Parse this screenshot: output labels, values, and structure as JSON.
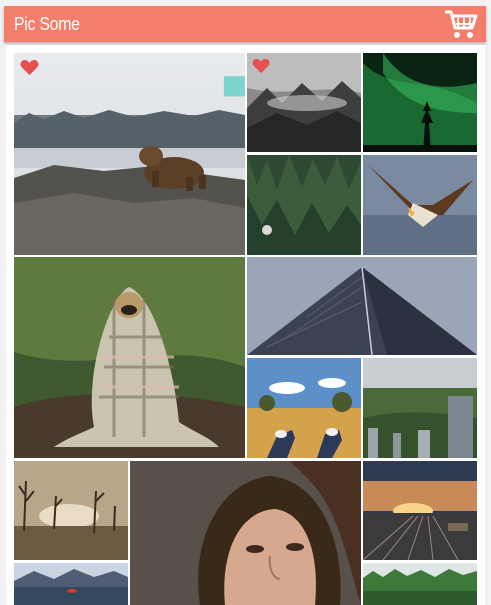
{
  "app": {
    "title": "Pic Some",
    "accent_color": "#f47e6c"
  },
  "header": {
    "cart_icon": "cart-icon"
  },
  "gallery": {
    "photos": [
      {
        "name": "photo-bear",
        "subject": "bear",
        "favorited": true,
        "in_cart": false
      },
      {
        "name": "photo-foggy-forest",
        "subject": "foggy-forest",
        "favorited": true,
        "in_cart": false
      },
      {
        "name": "photo-aurora",
        "subject": "aurora",
        "favorited": false,
        "in_cart": false
      },
      {
        "name": "photo-green-forest",
        "subject": "green-forest",
        "favorited": false,
        "in_cart": false
      },
      {
        "name": "photo-eagle",
        "subject": "eagle",
        "favorited": false,
        "in_cart": false
      },
      {
        "name": "photo-pug-blanket",
        "subject": "pug-in-blanket",
        "favorited": false,
        "in_cart": false
      },
      {
        "name": "photo-skyscraper",
        "subject": "skyscraper",
        "favorited": false,
        "in_cart": false
      },
      {
        "name": "photo-field-feet",
        "subject": "feet-in-field",
        "favorited": false,
        "in_cart": false
      },
      {
        "name": "photo-city-skyline",
        "subject": "city-park-skyline",
        "favorited": false,
        "in_cart": false
      },
      {
        "name": "photo-dead-trees",
        "subject": "dead-trees-lake",
        "favorited": false,
        "in_cart": false
      },
      {
        "name": "photo-woman-portrait",
        "subject": "woman-portrait",
        "favorited": false,
        "in_cart": false
      },
      {
        "name": "photo-rail-sunset",
        "subject": "railyard-sunset",
        "favorited": false,
        "in_cart": false
      },
      {
        "name": "photo-snowy-lake",
        "subject": "snowy-lake",
        "favorited": false,
        "in_cart": false
      },
      {
        "name": "photo-green-trees",
        "subject": "green-treeline",
        "favorited": false,
        "in_cart": false
      }
    ]
  },
  "icons": {
    "favorite": "heart-icon",
    "add_to_cart": "add-to-cart-icon"
  }
}
